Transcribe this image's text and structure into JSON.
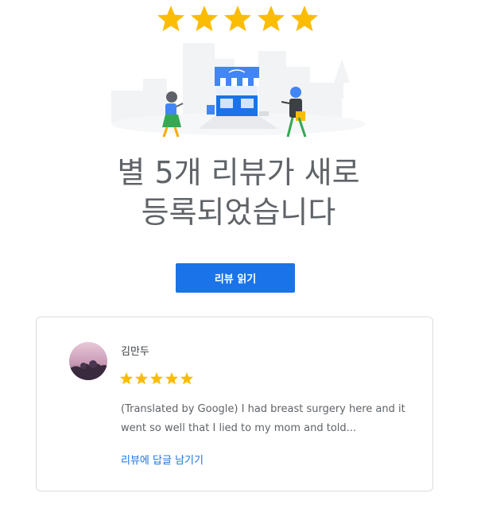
{
  "hero": {
    "star_count": 5,
    "star_color": "#fbbc04",
    "headline_line1": "별 5개 리뷰가 새로",
    "headline_line2": "등록되었습니다"
  },
  "cta": {
    "label": "리뷰 읽기",
    "color": "#1a73e8"
  },
  "review": {
    "reviewer_name": "김만두",
    "rating": 5,
    "text": "(Translated by Google) I had breast surgery here and it went so well that I lied to my mom and told...",
    "reply_link": "리뷰에 답글 남기기",
    "link_color": "#1a73e8"
  },
  "icons": {
    "hero_star": "star-icon",
    "rating_star": "star-icon",
    "illustration": "storefront-illustration"
  }
}
